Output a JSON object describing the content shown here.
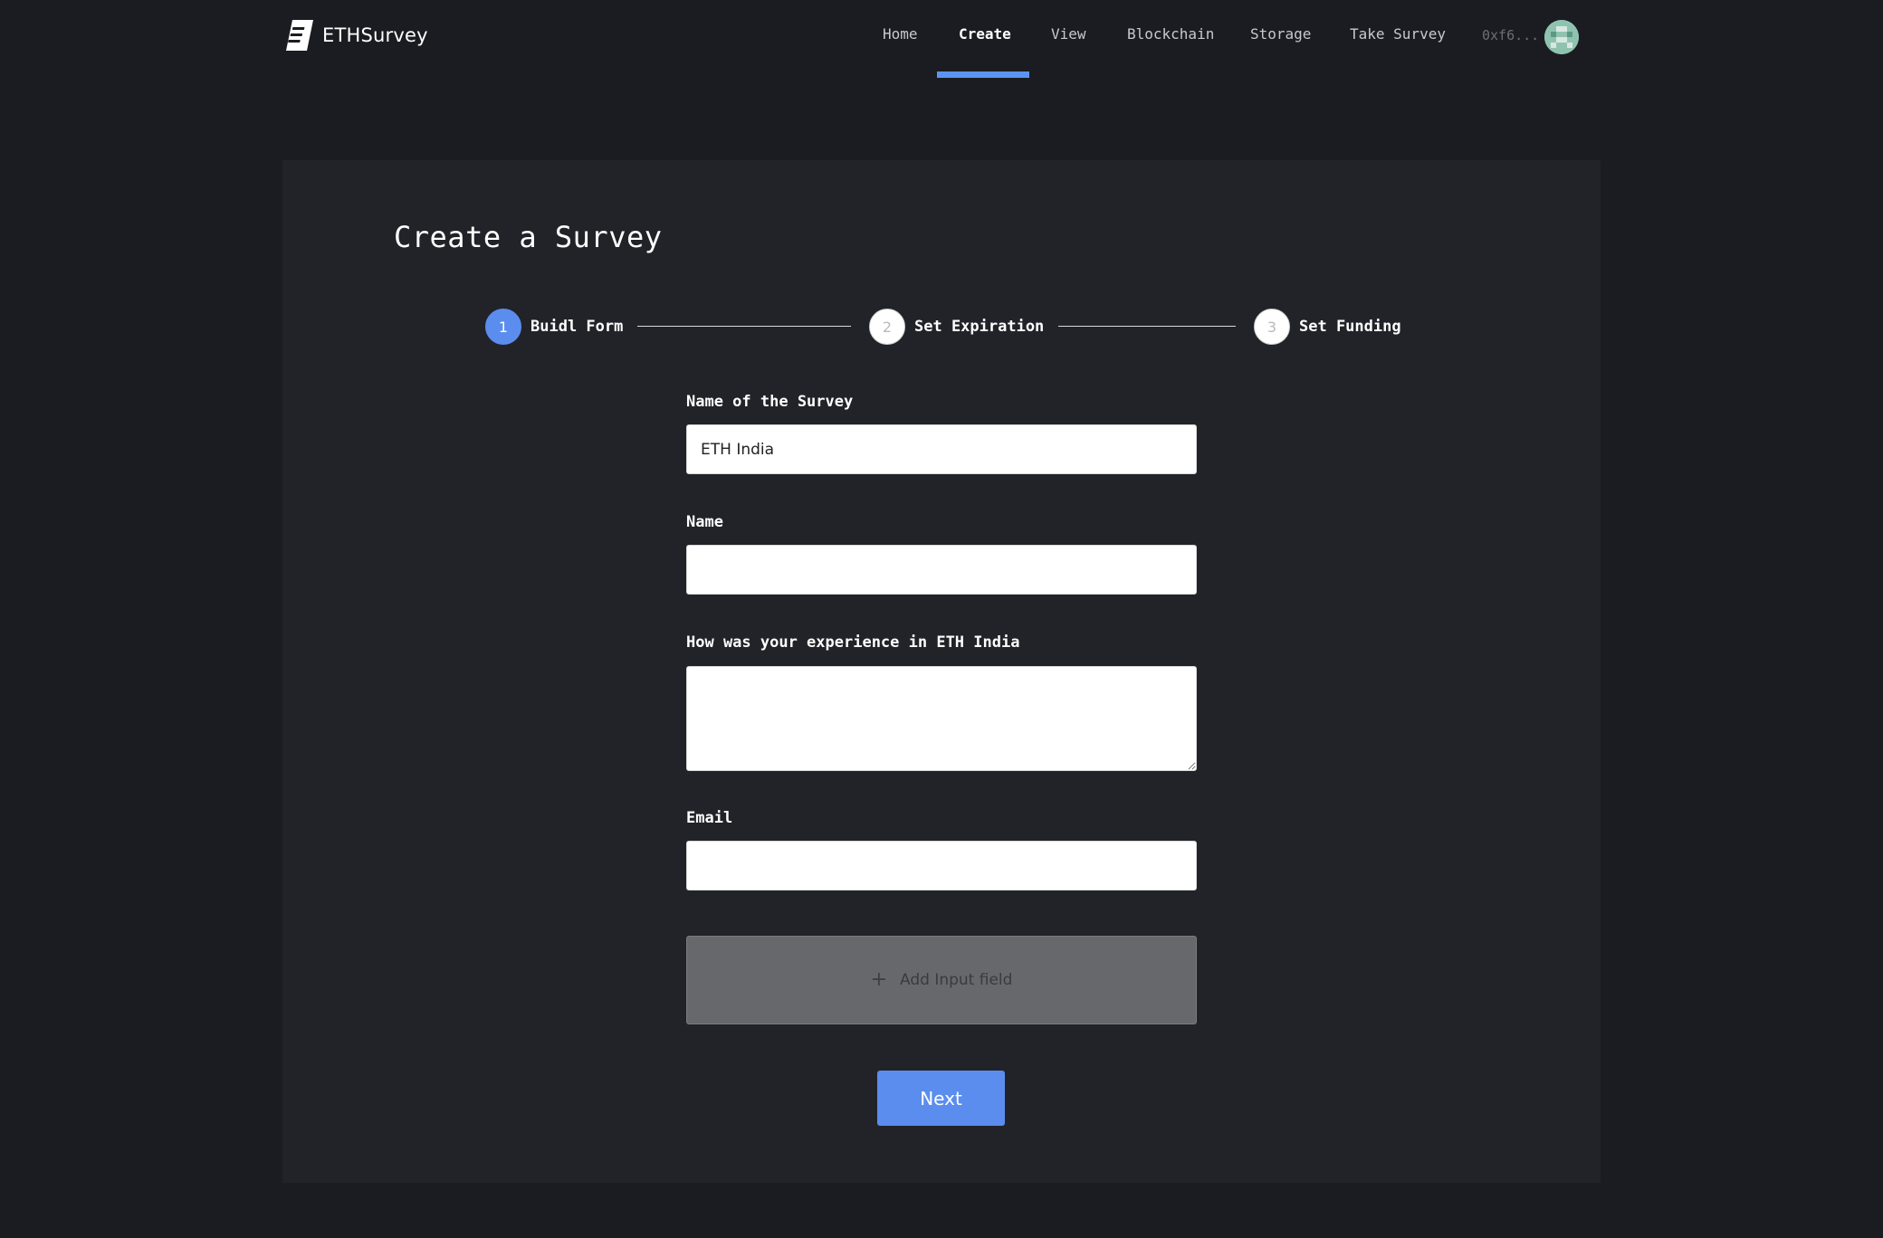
{
  "app": {
    "name": "ETHSurvey"
  },
  "nav": {
    "items": [
      {
        "label": "Home"
      },
      {
        "label": "Create"
      },
      {
        "label": "View"
      },
      {
        "label": "Blockchain"
      },
      {
        "label": "Storage"
      },
      {
        "label": "Take Survey"
      }
    ],
    "active": "Create",
    "account": "0xf6..."
  },
  "page": {
    "title": "Create a Survey"
  },
  "steps": [
    {
      "number": "1",
      "label": "Buidl Form",
      "active": true
    },
    {
      "number": "2",
      "label": "Set Expiration",
      "active": false
    },
    {
      "number": "3",
      "label": "Set Funding",
      "active": false
    }
  ],
  "form": {
    "survey_name": {
      "label": "Name of the Survey",
      "value": "ETH India"
    },
    "name": {
      "label": "Name",
      "value": ""
    },
    "experience": {
      "label": "How was your experience in ETH India",
      "value": ""
    },
    "email": {
      "label": "Email",
      "value": ""
    },
    "add_field_label": "Add Input field",
    "next_label": "Next"
  },
  "colors": {
    "accent": "#5b8def",
    "background": "#1b1c21",
    "card": "#222328"
  }
}
